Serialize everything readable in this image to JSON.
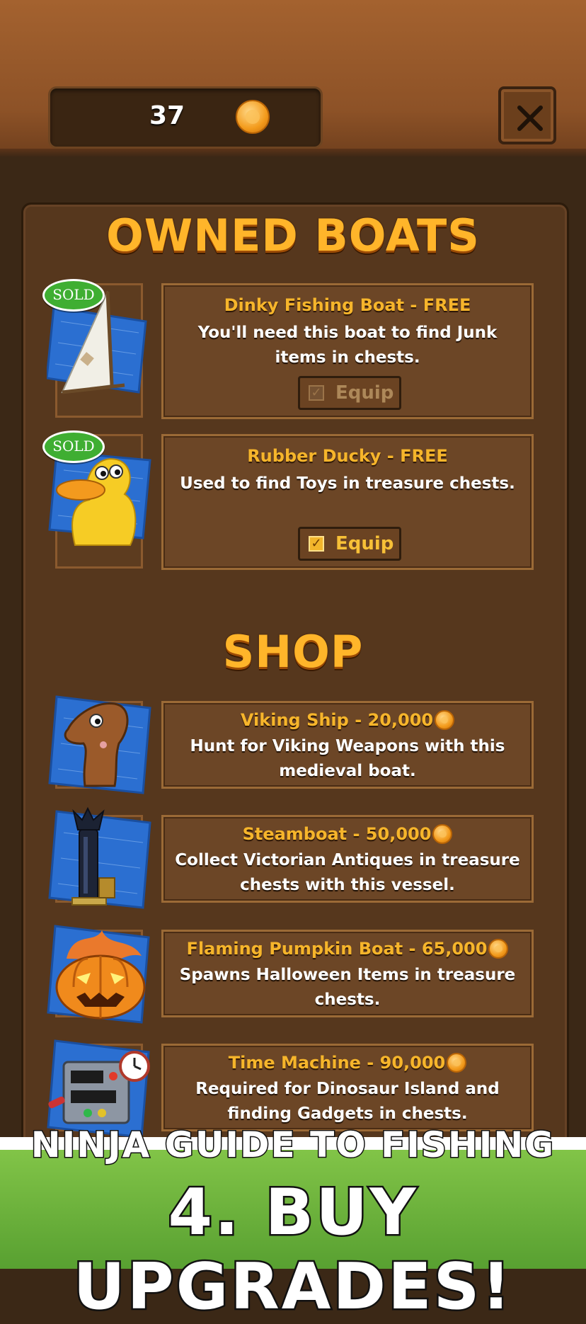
{
  "header": {
    "coins": "37",
    "close_icon": "close-icon"
  },
  "sections": {
    "owned_title": "OWNED BOATS",
    "shop_title": "SHOP"
  },
  "owned": [
    {
      "title": "Dinky Fishing Boat - FREE",
      "desc_line1": "You'll need this boat to find Junk",
      "desc_line2": "items in chests.",
      "badge": "SOLD",
      "equip_label": "Equip",
      "equipped": false,
      "icon": "sailboat-blueprint-icon"
    },
    {
      "title": "Rubber Ducky - FREE",
      "desc_line1": "Used to find Toys in treasure chests.",
      "desc_line2": "",
      "badge": "SOLD",
      "equip_label": "Equip",
      "equipped": true,
      "icon": "rubber-duck-blueprint-icon"
    }
  ],
  "shop": [
    {
      "title": "Viking Ship - 20,000",
      "desc_line1": "Hunt for Viking Weapons with this",
      "desc_line2": "medieval boat.",
      "icon": "viking-dragon-blueprint-icon"
    },
    {
      "title": "Steamboat - 50,000",
      "desc_line1": "Collect Victorian Antiques in treasure",
      "desc_line2": "chests with this vessel.",
      "icon": "steamboat-blueprint-icon"
    },
    {
      "title": "Flaming Pumpkin Boat - 65,000",
      "desc_line1": "Spawns Halloween Items in treasure",
      "desc_line2": "chests.",
      "icon": "flaming-pumpkin-blueprint-icon"
    },
    {
      "title": "Time Machine - 90,000",
      "desc_line1": "Required for Dinosaur Island and",
      "desc_line2": "finding Gadgets in chests.",
      "icon": "time-machine-blueprint-icon"
    }
  ],
  "banner": {
    "line1": "NINJA GUIDE TO FISHING",
    "line2": "4. BUY UPGRADES!"
  },
  "colors": {
    "accent": "#f6b52b",
    "panel": "#56371d",
    "sold_badge": "#3fae32",
    "banner_green": "#6bb43c"
  }
}
